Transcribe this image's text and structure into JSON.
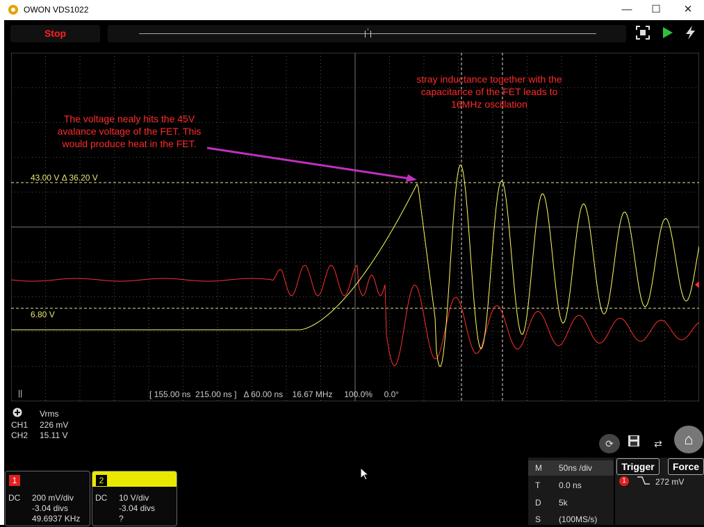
{
  "window": {
    "title": "OWON VDS1022",
    "minimize": "—",
    "maximize": "☐",
    "close": "✕"
  },
  "toolbar": {
    "stop_label": "Stop",
    "autoset_icon": "autoset-icon",
    "run_icon": "run-icon",
    "force_icon": "lightning-icon"
  },
  "annotations": {
    "left_note": "The voltage nealy hits the 45V\navalance voltage of the FET. This\nwould produce heat in the FET.",
    "right_note": "stray inductance together with the\ncapacitance of the FET leads to\n16MHz oscillation"
  },
  "cursors": {
    "upper_label": "43.00 V   Δ 36.20 V",
    "lower_label": "6.80 V"
  },
  "info_bar": {
    "pause": "||",
    "range": "[ 155.00 ns  215.00 ns ]",
    "delta": "Δ 60.00 ns",
    "freq": "16.67 MHz",
    "duty": "100.0%",
    "phase": "0.0°"
  },
  "measurements": {
    "header": "Vrms",
    "rows": [
      {
        "ch": "CH1",
        "value": "226 mV"
      },
      {
        "ch": "CH2",
        "value": "15.11 V"
      }
    ]
  },
  "channels": [
    {
      "num": "1",
      "coupling": "DC",
      "scale": "200 mV/div",
      "offset": "-3.04 divs",
      "freq": "49.6937 KHz",
      "color": "#ff3030"
    },
    {
      "num": "2",
      "coupling": "DC",
      "scale": "10 V/div",
      "offset": "-3.04 divs",
      "freq": "?",
      "color": "#ffff30"
    }
  ],
  "horizontal": {
    "rows": [
      {
        "key": "M",
        "value": "50ns /div"
      },
      {
        "key": "T",
        "value": "0.0 ns"
      },
      {
        "key": "D",
        "value": "5k"
      },
      {
        "key": "S",
        "value": "(100MS/s)"
      }
    ]
  },
  "trigger": {
    "label": "Trigger",
    "force_label": "Force",
    "channel": "1",
    "level": "272 mV"
  },
  "colors": {
    "ch1": "#ff3030",
    "ch2": "#ffff60",
    "grid": "#555555",
    "cursor": "#e8e8a0",
    "arrow": "#c030c0"
  }
}
